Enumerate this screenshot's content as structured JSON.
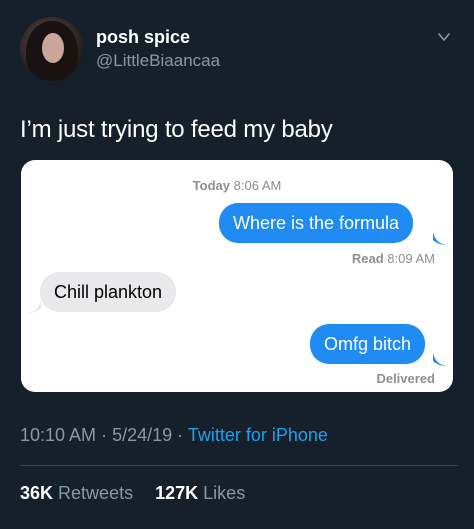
{
  "author": {
    "display_name": "posh spice",
    "handle": "@LittleBiaancaa"
  },
  "tweet": {
    "text": "I’m just trying to feed my baby"
  },
  "conversation": {
    "timestamp_day": "Today",
    "timestamp_time": "8:06 AM",
    "messages": [
      {
        "direction": "outgoing",
        "text": "Where is the formula"
      },
      {
        "direction": "incoming",
        "text": "Chill plankton"
      },
      {
        "direction": "outgoing",
        "text": "Omfg bitch"
      }
    ],
    "read_receipt_label": "Read",
    "read_receipt_time": "8:09 AM",
    "delivered_label": "Delivered"
  },
  "meta": {
    "time": "10:10 AM",
    "date": "5/24/19",
    "separator": "·",
    "source": "Twitter for iPhone"
  },
  "stats": {
    "retweets_count": "36K",
    "retweets_label": "Retweets",
    "likes_count": "127K",
    "likes_label": "Likes"
  },
  "colors": {
    "background": "#15202b",
    "accent": "#1da1f2",
    "imessage_blue": "#1f8bf3",
    "imessage_gray": "#e9e9eb"
  },
  "icons": {
    "menu": "chevron-down-icon"
  }
}
